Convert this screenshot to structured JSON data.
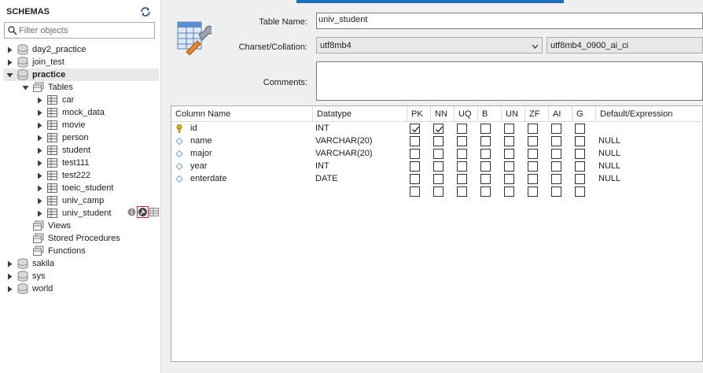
{
  "navigator": {
    "title": "SCHEMAS",
    "filter_placeholder": "Filter objects",
    "schemas": [
      {
        "name": "day2_practice",
        "expanded": false
      },
      {
        "name": "join_test",
        "expanded": false
      },
      {
        "name": "practice",
        "expanded": true
      },
      {
        "name": "sakila",
        "expanded": false
      },
      {
        "name": "sys",
        "expanded": false
      },
      {
        "name": "world",
        "expanded": false
      }
    ],
    "tables_label": "Tables",
    "tables": [
      "car",
      "mock_data",
      "movie",
      "person",
      "student",
      "test111",
      "test222",
      "toeic_student",
      "univ_camp",
      "univ_student"
    ],
    "views_label": "Views",
    "procedures_label": "Stored Procedures",
    "functions_label": "Functions"
  },
  "editor": {
    "table_name_label": "Table Name:",
    "table_name_value": "univ_student",
    "charset_label": "Charset/Collation:",
    "charset_value": "utf8mb4",
    "collation_value": "utf8mb4_0900_ai_ci",
    "comments_label": "Comments:",
    "columns_header": [
      "Column Name",
      "Datatype",
      "PK",
      "NN",
      "UQ",
      "B",
      "UN",
      "ZF",
      "AI",
      "G",
      "Default/Expression"
    ],
    "columns": [
      {
        "name": "id",
        "type": "INT",
        "pk": true,
        "nn": true,
        "default": "",
        "icon": "key-icon"
      },
      {
        "name": "name",
        "type": "VARCHAR(20)",
        "pk": false,
        "nn": false,
        "default": "NULL",
        "icon": "diamond-icon"
      },
      {
        "name": "major",
        "type": "VARCHAR(20)",
        "pk": false,
        "nn": false,
        "default": "NULL",
        "icon": "diamond-icon"
      },
      {
        "name": "year",
        "type": "INT",
        "pk": false,
        "nn": false,
        "default": "NULL",
        "icon": "diamond-icon"
      },
      {
        "name": "enterdate",
        "type": "DATE",
        "pk": false,
        "nn": false,
        "default": "NULL",
        "icon": "diamond-icon"
      }
    ]
  },
  "colors": {
    "accent": "#1e6fb8",
    "selected_row": "#e8e8e8"
  }
}
